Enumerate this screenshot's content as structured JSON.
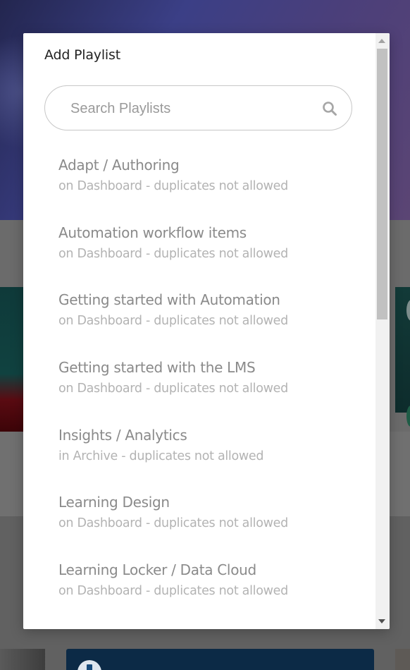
{
  "modal": {
    "title": "Add Playlist",
    "search": {
      "placeholder": "Search Playlists",
      "value": "",
      "icon": "search-icon"
    },
    "playlists": [
      {
        "name": "Adapt / Authoring",
        "meta": "on Dashboard - duplicates not allowed"
      },
      {
        "name": "Automation workflow items",
        "meta": "on Dashboard - duplicates not allowed"
      },
      {
        "name": "Getting started with Automation",
        "meta": "on Dashboard - duplicates not allowed"
      },
      {
        "name": "Getting started with the LMS",
        "meta": "on Dashboard - duplicates not allowed"
      },
      {
        "name": "Insights / Analytics",
        "meta": "in Archive - duplicates not allowed"
      },
      {
        "name": "Learning Design",
        "meta": "on Dashboard - duplicates not allowed"
      },
      {
        "name": "Learning Locker / Data Cloud",
        "meta": "on Dashboard - duplicates not allowed"
      }
    ]
  },
  "colors": {
    "title": "#222222",
    "item_name": "#8a8a8a",
    "item_meta": "#b3b3b3",
    "search_border": "#c7c7c7",
    "search_icon": "#a6a6a6",
    "scroll_thumb": "#c1c1c1"
  }
}
